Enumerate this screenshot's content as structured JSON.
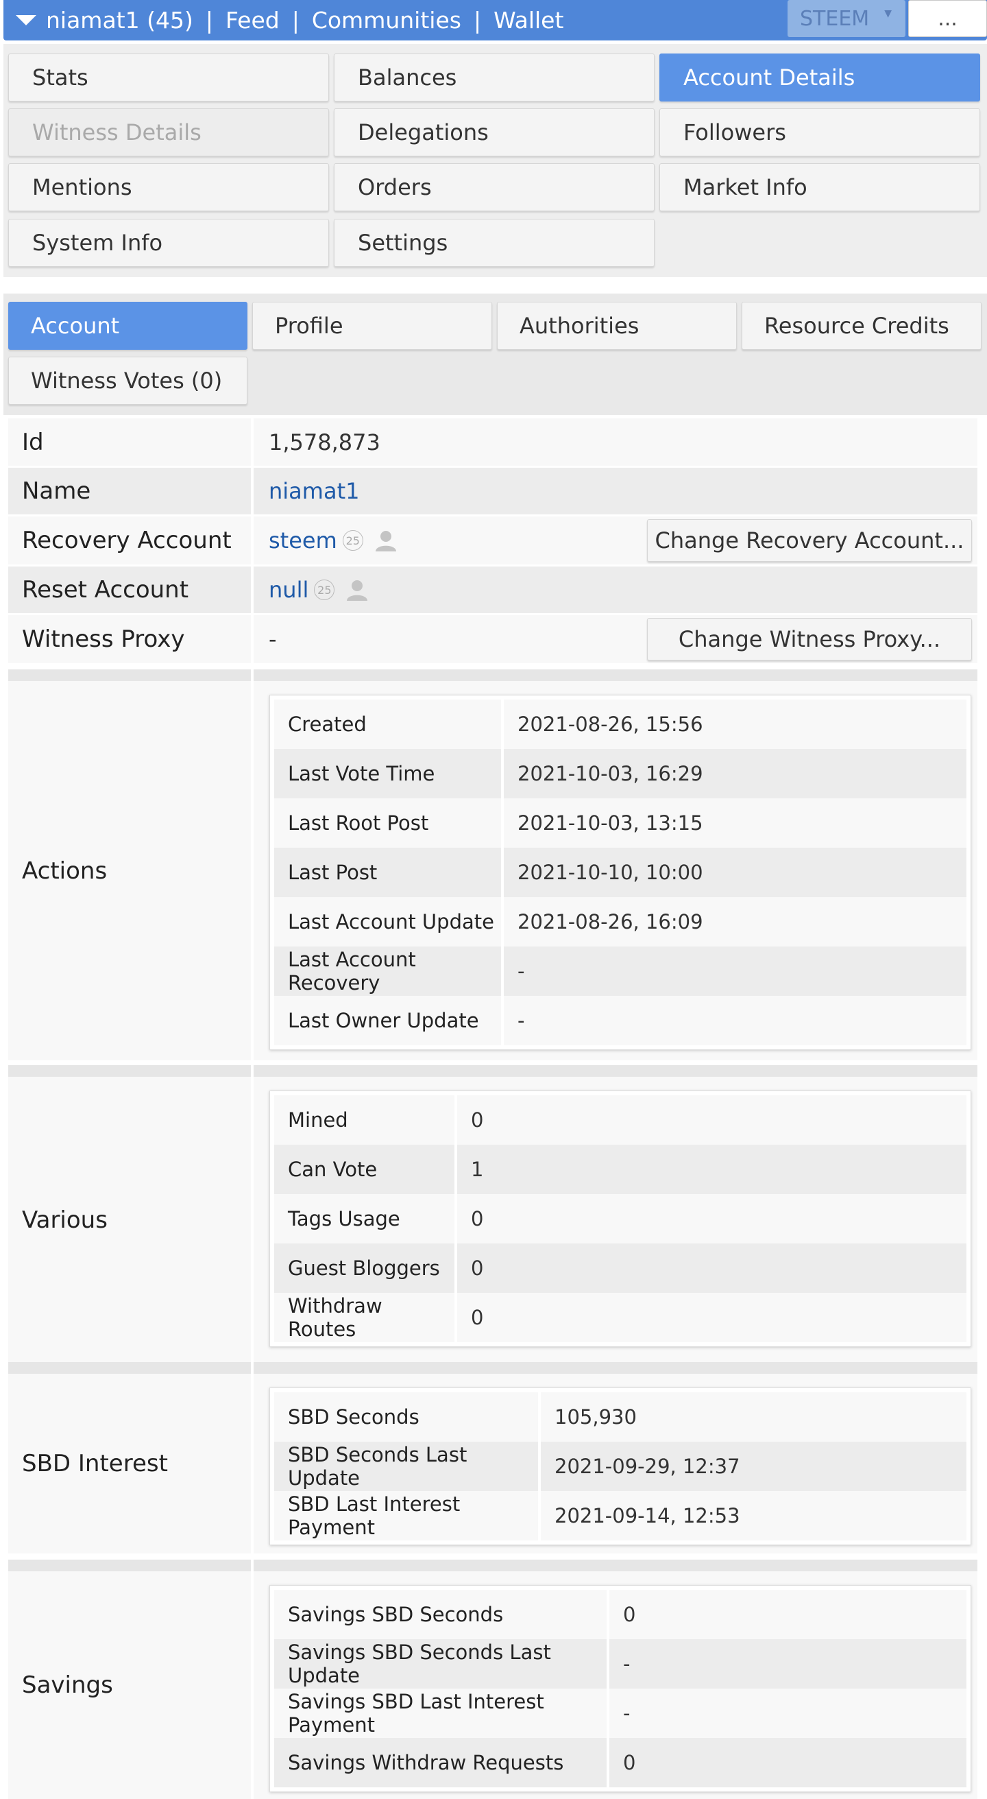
{
  "topbar": {
    "account": "niamat1 (45)",
    "nav": [
      "Feed",
      "Communities",
      "Wallet"
    ],
    "separator": "|",
    "chain": "STEEM",
    "more": "..."
  },
  "menu": {
    "items": [
      "Stats",
      "Balances",
      "Account Details",
      "Witness Details",
      "Delegations",
      "Followers",
      "Mentions",
      "Orders",
      "Market Info",
      "System Info",
      "Settings"
    ],
    "active": "Account Details",
    "disabled": "Witness Details"
  },
  "tabs": {
    "items": [
      "Account",
      "Profile",
      "Authorities",
      "Resource Credits",
      "Witness Votes (0)"
    ],
    "active": "Account"
  },
  "account": {
    "id_label": "Id",
    "id_value": "1,578,873",
    "name_label": "Name",
    "name_value": "niamat1",
    "recovery_label": "Recovery Account",
    "recovery_value": "steem",
    "recovery_badge": "25",
    "recovery_button": "Change Recovery Account...",
    "reset_label": "Reset Account",
    "reset_value": "null",
    "reset_badge": "25",
    "proxy_label": "Witness Proxy",
    "proxy_value": "-",
    "proxy_button": "Change Witness Proxy..."
  },
  "actions": {
    "label": "Actions",
    "rows": [
      {
        "k": "Created",
        "v": "2021-08-26, 15:56"
      },
      {
        "k": "Last Vote Time",
        "v": "2021-10-03, 16:29"
      },
      {
        "k": "Last Root Post",
        "v": "2021-10-03, 13:15"
      },
      {
        "k": "Last Post",
        "v": "2021-10-10, 10:00"
      },
      {
        "k": "Last Account Update",
        "v": "2021-08-26, 16:09"
      },
      {
        "k": "Last Account Recovery",
        "v": "-"
      },
      {
        "k": "Last Owner Update",
        "v": "-"
      }
    ]
  },
  "various": {
    "label": "Various",
    "rows": [
      {
        "k": "Mined",
        "v": "0"
      },
      {
        "k": "Can Vote",
        "v": "1"
      },
      {
        "k": "Tags Usage",
        "v": "0"
      },
      {
        "k": "Guest Bloggers",
        "v": "0"
      },
      {
        "k": "Withdraw Routes",
        "v": "0"
      }
    ]
  },
  "sbd_interest": {
    "label": "SBD Interest",
    "rows": [
      {
        "k": "SBD Seconds",
        "v": "105,930"
      },
      {
        "k": "SBD Seconds Last Update",
        "v": "2021-09-29, 12:37"
      },
      {
        "k": "SBD Last Interest Payment",
        "v": "2021-09-14, 12:53"
      }
    ]
  },
  "savings": {
    "label": "Savings",
    "rows": [
      {
        "k": "Savings SBD Seconds",
        "v": "0"
      },
      {
        "k": "Savings SBD Seconds Last Update",
        "v": "-"
      },
      {
        "k": "Savings SBD Last Interest Payment",
        "v": "-"
      },
      {
        "k": "Savings Withdraw Requests",
        "v": "0"
      }
    ]
  }
}
